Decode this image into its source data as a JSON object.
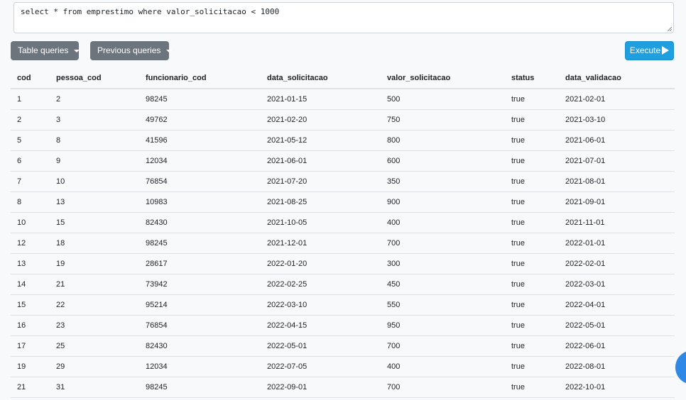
{
  "query": {
    "text": "select * from emprestimo where valor_solicitacao < 1000"
  },
  "toolbar": {
    "table_queries": "Table queries",
    "previous_queries": "Previous queries",
    "execute": "Execute"
  },
  "results": {
    "columns": [
      "cod",
      "pessoa_cod",
      "funcionario_cod",
      "data_solicitacao",
      "valor_solicitacao",
      "status",
      "data_validacao"
    ],
    "rows": [
      [
        "1",
        "2",
        "98245",
        "2021-01-15",
        "500",
        "true",
        "2021-02-01"
      ],
      [
        "2",
        "3",
        "49762",
        "2021-02-20",
        "750",
        "true",
        "2021-03-10"
      ],
      [
        "5",
        "8",
        "41596",
        "2021-05-12",
        "800",
        "true",
        "2021-06-01"
      ],
      [
        "6",
        "9",
        "12034",
        "2021-06-01",
        "600",
        "true",
        "2021-07-01"
      ],
      [
        "7",
        "10",
        "76854",
        "2021-07-20",
        "350",
        "true",
        "2021-08-01"
      ],
      [
        "8",
        "13",
        "10983",
        "2021-08-25",
        "900",
        "true",
        "2021-09-01"
      ],
      [
        "10",
        "15",
        "82430",
        "2021-10-05",
        "400",
        "true",
        "2021-11-01"
      ],
      [
        "12",
        "18",
        "98245",
        "2021-12-01",
        "700",
        "true",
        "2022-01-01"
      ],
      [
        "13",
        "19",
        "28617",
        "2022-01-20",
        "300",
        "true",
        "2022-02-01"
      ],
      [
        "14",
        "21",
        "73942",
        "2022-02-25",
        "450",
        "true",
        "2022-03-01"
      ],
      [
        "15",
        "22",
        "95214",
        "2022-03-10",
        "550",
        "true",
        "2022-04-01"
      ],
      [
        "16",
        "23",
        "76854",
        "2022-04-15",
        "950",
        "true",
        "2022-05-01"
      ],
      [
        "17",
        "25",
        "82430",
        "2022-05-01",
        "700",
        "true",
        "2022-06-01"
      ],
      [
        "19",
        "29",
        "12034",
        "2022-07-05",
        "400",
        "true",
        "2022-08-01"
      ],
      [
        "21",
        "31",
        "98245",
        "2022-09-01",
        "700",
        "true",
        "2022-10-01"
      ]
    ]
  },
  "icons": {
    "dropdown": "caret-down-icon",
    "execute": "play-icon",
    "resize": "resize-grip-icon"
  },
  "colors": {
    "secondary_button": "#6c757d",
    "execute_button": "#1d9fe0",
    "floating_button": "#2f88e6"
  }
}
